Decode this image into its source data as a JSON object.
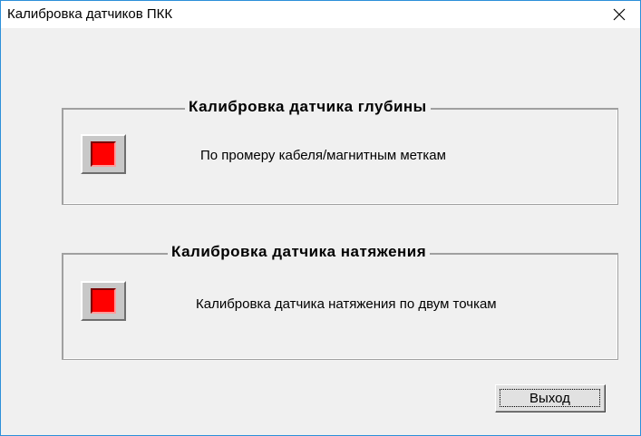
{
  "window": {
    "title": "Калибровка датчиков ПКК",
    "close_icon": "close-icon"
  },
  "groups": [
    {
      "title": "Калибровка датчика глубины",
      "button_label": "По промеру кабеля/магнитным меткам",
      "button_color": "#ff0000"
    },
    {
      "title": "Калибровка датчика натяжения",
      "button_label": "Калибровка датчика натяжения по двум точкам",
      "button_color": "#ff0000"
    }
  ],
  "exit_button": {
    "label": "Выход"
  }
}
